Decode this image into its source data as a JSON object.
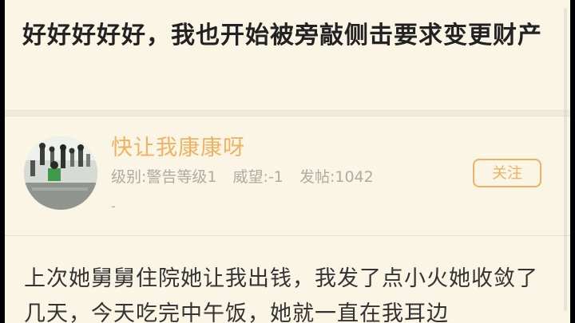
{
  "post": {
    "title": "好好好好好，我也开始被旁敲侧击要求变更财产"
  },
  "author": {
    "name": "快让我康康呀",
    "level": "级别:警告等级1",
    "prestige": "威望:-1",
    "posts": "发帖:1042",
    "signature": "-",
    "follow_label": "关注"
  },
  "content": {
    "text": "上次她舅舅住院她让我出钱，我发了点小火她收敛了几天，今天吃完中午饭，她就一直在我耳边"
  },
  "colors": {
    "background": "#fbf5e6",
    "accent": "#f0b262",
    "meta_text": "#b0aba0",
    "body_text": "#333333"
  }
}
